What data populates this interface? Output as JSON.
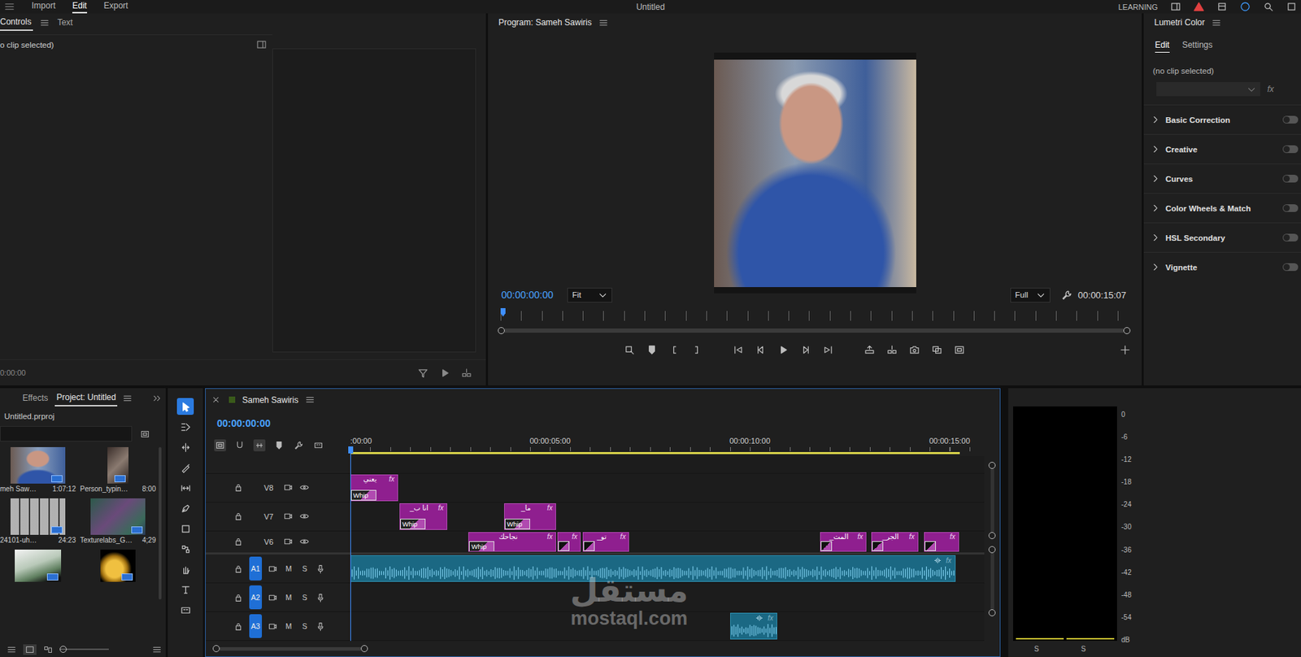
{
  "menu": {
    "items": [
      {
        "label": "Import",
        "selected": false
      },
      {
        "label": "Edit",
        "selected": true
      },
      {
        "label": "Export",
        "selected": false
      }
    ],
    "title": "Untitled",
    "workspace": "LEARNING"
  },
  "effect_controls": {
    "tabs": [
      {
        "label": "Controls",
        "selected": true
      },
      {
        "label": "Text",
        "selected": false
      }
    ],
    "message": "o clip selected)",
    "timecode": "0:00:00"
  },
  "program": {
    "title": "Program: Sameh Sawiris",
    "timecode": "00:00:00:00",
    "zoom": "Fit",
    "quality": "Full",
    "duration": "00:00:15:07",
    "playhead": 0
  },
  "lumetri": {
    "title": "Lumetri Color",
    "tabs": [
      {
        "label": "Edit",
        "selected": true
      },
      {
        "label": "Settings",
        "selected": false
      }
    ],
    "message": "(no clip selected)",
    "fx": "fx",
    "sections": [
      {
        "label": "Basic Correction",
        "on": false
      },
      {
        "label": "Creative",
        "on": false
      },
      {
        "label": "Curves",
        "on": false
      },
      {
        "label": "Color Wheels & Match",
        "on": false
      },
      {
        "label": "HSL Secondary",
        "on": false
      },
      {
        "label": "Vignette",
        "on": false
      }
    ]
  },
  "project": {
    "tabs": [
      {
        "label": "Effects",
        "selected": false
      },
      {
        "label": "Project: Untitled",
        "selected": true
      }
    ],
    "file": "Untitled.prproj",
    "items": [
      {
        "name": "meh Saw…",
        "duration": "1:07:12",
        "kind": "portrait"
      },
      {
        "name": "Person_typin…",
        "duration": "8:00",
        "kind": "typing"
      },
      {
        "name": "24101-uh…",
        "duration": "24:23",
        "kind": "grid"
      },
      {
        "name": "Texturelabs_G…",
        "duration": "4;29",
        "kind": "texture"
      },
      {
        "name": "",
        "duration": "",
        "kind": "money"
      },
      {
        "name": "",
        "duration": "",
        "kind": "coins"
      }
    ]
  },
  "timeline": {
    "title": "Sameh Sawiris",
    "timecode": "00:00:00:00",
    "playhead": 0,
    "work_area": {
      "start": 0,
      "end": 15.25
    },
    "ruler": [
      {
        "label": ":00:00",
        "time": 0
      },
      {
        "label": "00:00:05:00",
        "time": 5
      },
      {
        "label": "00:00:10:00",
        "time": 10
      },
      {
        "label": "00:00:15:00",
        "time": 15
      }
    ],
    "tracks": [
      {
        "name": "V8",
        "kind": "video",
        "targeted": false,
        "clips": [
          {
            "start": 0,
            "end": 1.19,
            "label": "يعني",
            "fx": "fx",
            "effect": "Whip"
          }
        ]
      },
      {
        "name": "V7",
        "kind": "video",
        "targeted": false,
        "clips": [
          {
            "start": 1.23,
            "end": 2.42,
            "label": "انا ب_",
            "fx": "fx",
            "effect": "Whip"
          },
          {
            "start": 3.85,
            "end": 5.15,
            "label": "ما_",
            "fx": "fx",
            "effect": "Whip"
          }
        ]
      },
      {
        "name": "V6",
        "kind": "video",
        "targeted": false,
        "clips": [
          {
            "start": 2.96,
            "end": 5.15,
            "label": "نجاحك",
            "fx": "fx",
            "effect": "Whip"
          },
          {
            "start": 5.19,
            "end": 5.77,
            "label": "",
            "fx": "fx",
            "effect": ""
          },
          {
            "start": 5.81,
            "end": 6.98,
            "label": "تو_",
            "fx": "fx",
            "effect": ""
          },
          {
            "start": 11.75,
            "end": 12.92,
            "label": "المث_",
            "fx": "fx",
            "effect": ""
          },
          {
            "start": 13.04,
            "end": 14.21,
            "label": "الجر_",
            "fx": "fx",
            "effect": ""
          },
          {
            "start": 14.35,
            "end": 15.23,
            "label": "",
            "fx": "fx",
            "effect": ""
          }
        ]
      },
      {
        "name": "A1",
        "kind": "audio",
        "targeted": true,
        "mute": "M",
        "solo": "S",
        "clips": [
          {
            "start": 0,
            "end": 15.15,
            "fx": "fx"
          }
        ]
      },
      {
        "name": "A2",
        "kind": "audio",
        "targeted": true,
        "mute": "M",
        "solo": "S",
        "clips": []
      },
      {
        "name": "A3",
        "kind": "audio",
        "targeted": true,
        "mute": "M",
        "solo": "S",
        "clips": [
          {
            "start": 9.5,
            "end": 10.69,
            "fx": "fx"
          }
        ]
      }
    ]
  },
  "meter": {
    "scale": [
      "0",
      "-6",
      "-12",
      "-18",
      "-24",
      "-30",
      "-36",
      "-42",
      "-48",
      "-54",
      "dB"
    ],
    "channels": [
      {
        "label": "S",
        "level": 0
      },
      {
        "label": "S",
        "level": 0
      }
    ]
  },
  "watermark": {
    "logo": "مستقل",
    "url": "mostaql.com"
  }
}
